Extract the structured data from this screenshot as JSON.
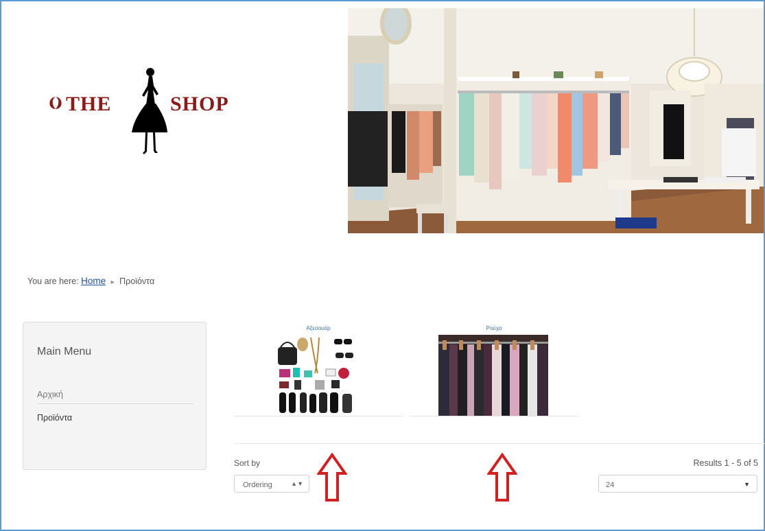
{
  "logo": {
    "text_left": "THE",
    "text_right": "SHOP"
  },
  "breadcrumb": {
    "prefix": "You are here:",
    "home": "Home",
    "separator": "▸",
    "current": "Προϊόντα"
  },
  "sidebar": {
    "title": "Main Menu",
    "items": [
      {
        "label": "Αρχική"
      },
      {
        "label": "Προϊόντα"
      }
    ]
  },
  "categories": [
    {
      "title": "Αξεσουάρ"
    },
    {
      "title": "Ρούχα"
    }
  ],
  "sort": {
    "label": "Sort by",
    "value": "Ordering"
  },
  "results": {
    "text": "Results 1 - 5 of 5"
  },
  "limit": {
    "value": "24"
  },
  "colors": {
    "brand": "#8b1a1a",
    "link": "#1f4e9c",
    "arrow": "#d21f1f",
    "frame": "#5b9bd5"
  }
}
